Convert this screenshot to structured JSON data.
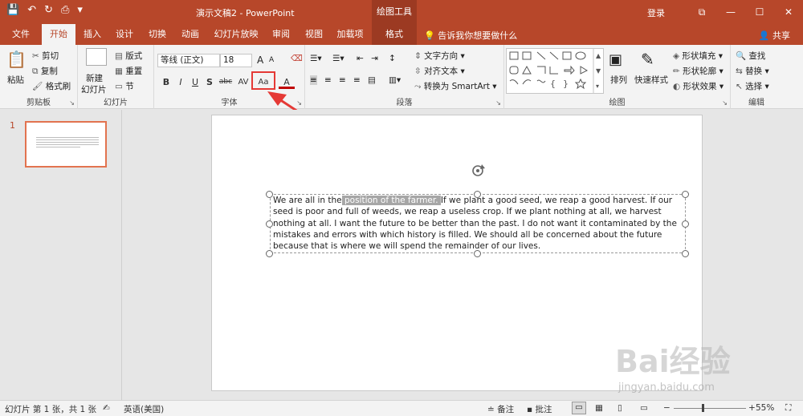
{
  "titlebar": {
    "doc_title": "演示文稿2 - PowerPoint",
    "context_tab_title": "绘图工具",
    "login": "登录",
    "qat": [
      "💾",
      "↶",
      "↻",
      "⎙",
      "▾"
    ],
    "window_buttons": [
      "⧉",
      "—",
      "☐",
      "✕"
    ]
  },
  "tabs": [
    "文件",
    "开始",
    "插入",
    "设计",
    "切换",
    "动画",
    "幻灯片放映",
    "审阅",
    "视图",
    "加载项",
    "格式"
  ],
  "tell_me": "告诉我你想要做什么",
  "share": "共享",
  "ribbon": {
    "clipboard": {
      "label": "剪贴板",
      "paste": "粘贴",
      "cut": "剪切",
      "copy": "复制",
      "format_painter": "格式刷"
    },
    "slides": {
      "label": "幻灯片",
      "new_slide_1": "新建",
      "new_slide_2": "幻灯片",
      "layout": "版式",
      "reset": "重置",
      "section": "节"
    },
    "font": {
      "label": "字体",
      "font_name": "等线 (正文)",
      "font_size": "18",
      "bold": "B",
      "italic": "I",
      "underline": "U",
      "shadow": "S",
      "strike": "abc",
      "spacing": "AV",
      "change_case": "Aa",
      "font_color": "A",
      "grow": "A",
      "shrink": "A"
    },
    "paragraph": {
      "label": "段落",
      "text_direction": "文字方向",
      "align_text": "对齐文本",
      "smartart": "转换为 SmartArt"
    },
    "drawing": {
      "label": "绘图",
      "arrange": "排列",
      "quick_styles": "快速样式",
      "fill": "形状填充",
      "outline": "形状轮廓",
      "effects": "形状效果"
    },
    "editing": {
      "label": "编辑",
      "find": "查找",
      "replace": "替换",
      "select": "选择"
    }
  },
  "thumbnail": {
    "number": "1"
  },
  "slide_text": {
    "before": "We are all in the",
    "highlight": " position of the farmer. ",
    "after": "If we plant a good seed, we reap a good harvest. If our seed is poor and full of weeds, we reap a useless crop. If we plant nothing at all, we harvest nothing at all. I want the future to be better than the past. I do not want it contaminated by the mistakes and errors with which history is filled. We should all be concerned about the future because that is where we will spend the remainder of our lives."
  },
  "status": {
    "slide_info": "幻灯片 第 1 张，共 1 张",
    "language": "英语(美国)",
    "notes": "备注",
    "comments": "批注",
    "zoom": "55%",
    "zoom_minus": "−",
    "zoom_plus": "+"
  },
  "watermark": {
    "brand": "Bai经验",
    "url": "jingyan.baidu.com"
  },
  "colors": {
    "accent": "#b7472a",
    "context": "#9c3a22",
    "highlight_box": "#e53935"
  }
}
